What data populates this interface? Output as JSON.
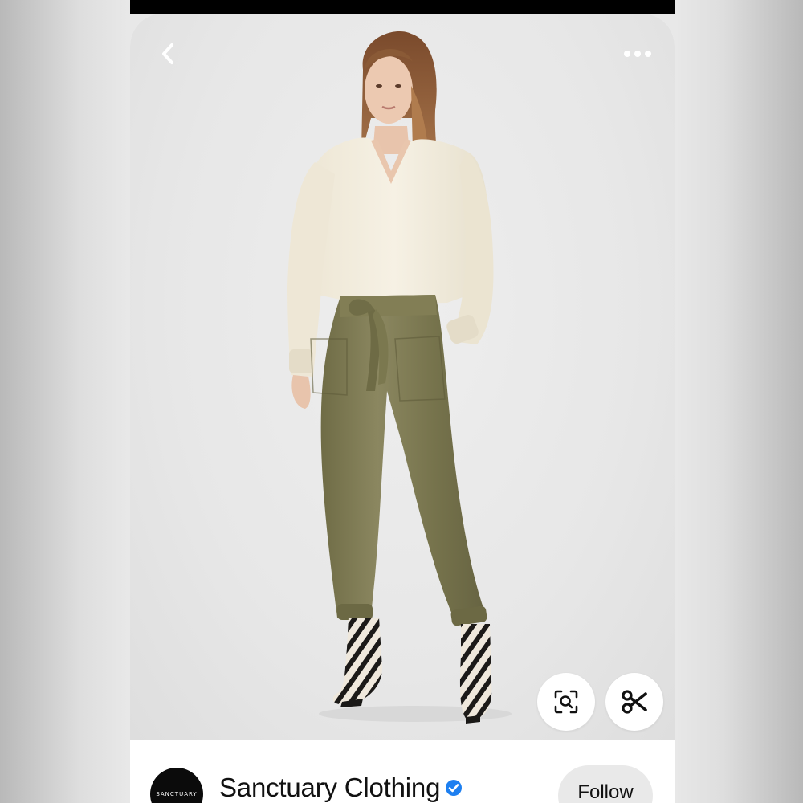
{
  "pin": {
    "image_alt": "Model wearing cream v-neck sweater, olive satin tie-waist jogger pants and zebra print ankle boots"
  },
  "toolbar": {
    "back_icon": "chevron-left-icon",
    "more_icon": "ellipsis-icon"
  },
  "actions": {
    "visual_search_icon": "lens-search-icon",
    "cutout_icon": "scissors-icon"
  },
  "profile": {
    "name": "Sanctuary Clothing",
    "avatar_text": "SANCTUARY",
    "verified_icon": "verified-badge-icon",
    "verified_color": "#1d7ff0",
    "follow_label": "Follow"
  },
  "colors": {
    "sweater": "#f1ebdc",
    "pants": "#7d7a54",
    "background": "#e8e8e8"
  }
}
